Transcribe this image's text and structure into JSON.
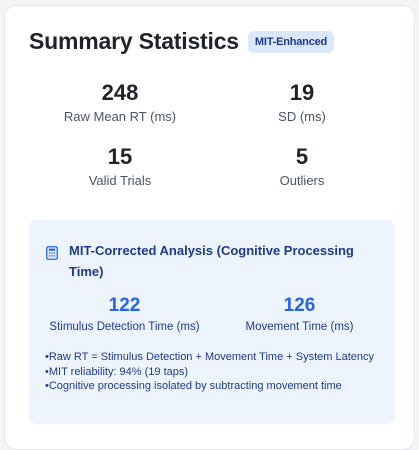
{
  "summary": {
    "title": "Summary Statistics",
    "badge": "MIT-Enhanced",
    "stats": [
      {
        "value": "248",
        "label": "Raw Mean RT (ms)"
      },
      {
        "value": "19",
        "label": "SD (ms)"
      },
      {
        "value": "15",
        "label": "Valid Trials"
      },
      {
        "value": "5",
        "label": "Outliers"
      }
    ]
  },
  "mit": {
    "icon": "calculator-icon",
    "title": "MIT-Corrected Analysis (Cognitive Processing Time)",
    "stats": [
      {
        "value": "122",
        "label": "Stimulus Detection Time (ms)"
      },
      {
        "value": "126",
        "label": "Movement Time (ms)"
      }
    ],
    "notes": [
      "Raw RT = Stimulus Detection + Movement Time + System Latency",
      "MIT reliability: 94% (19 taps)",
      "Cognitive processing isolated by subtracting movement time"
    ]
  },
  "colors": {
    "accent": "#2563eb",
    "accent_dark": "#1e3a8a",
    "badge_bg": "#dbe8fb",
    "panel_bg": "#edf4fd"
  }
}
